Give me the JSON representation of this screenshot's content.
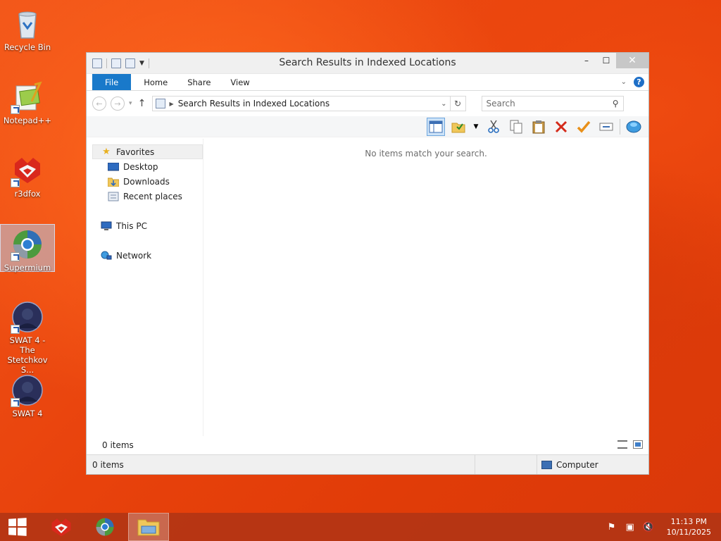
{
  "desktop": {
    "icons": [
      {
        "label": "Recycle Bin"
      },
      {
        "label": "Notepad++"
      },
      {
        "label": "r3dfox"
      },
      {
        "label": "Supermium"
      },
      {
        "label": "SWAT 4 - The Stetchkov S..."
      },
      {
        "label": "SWAT 4"
      }
    ]
  },
  "window": {
    "title": "Search Results in Indexed Locations",
    "controls": {
      "minimize": "–",
      "maximize": "☐",
      "close": "✕"
    },
    "ribbon": {
      "tabs": [
        "File",
        "Home",
        "Share",
        "View"
      ],
      "help": "?"
    },
    "address": {
      "path": "Search Results in Indexed Locations"
    },
    "search": {
      "placeholder": "Search"
    },
    "navpane": {
      "favorites": "Favorites",
      "favorites_items": [
        "Desktop",
        "Downloads",
        "Recent places"
      ],
      "this_pc": "This PC",
      "network": "Network"
    },
    "empty_message": "No items match your search.",
    "item_count": "0 items",
    "statusbar": {
      "items": "0 items",
      "zone": "Computer"
    }
  },
  "taskbar": {
    "clock": {
      "time": "11:13 PM",
      "date": "10/11/2025"
    }
  },
  "colors": {
    "accent": "#1979ca",
    "wallpaper": "#e8420c",
    "taskbar": "#b03414"
  }
}
